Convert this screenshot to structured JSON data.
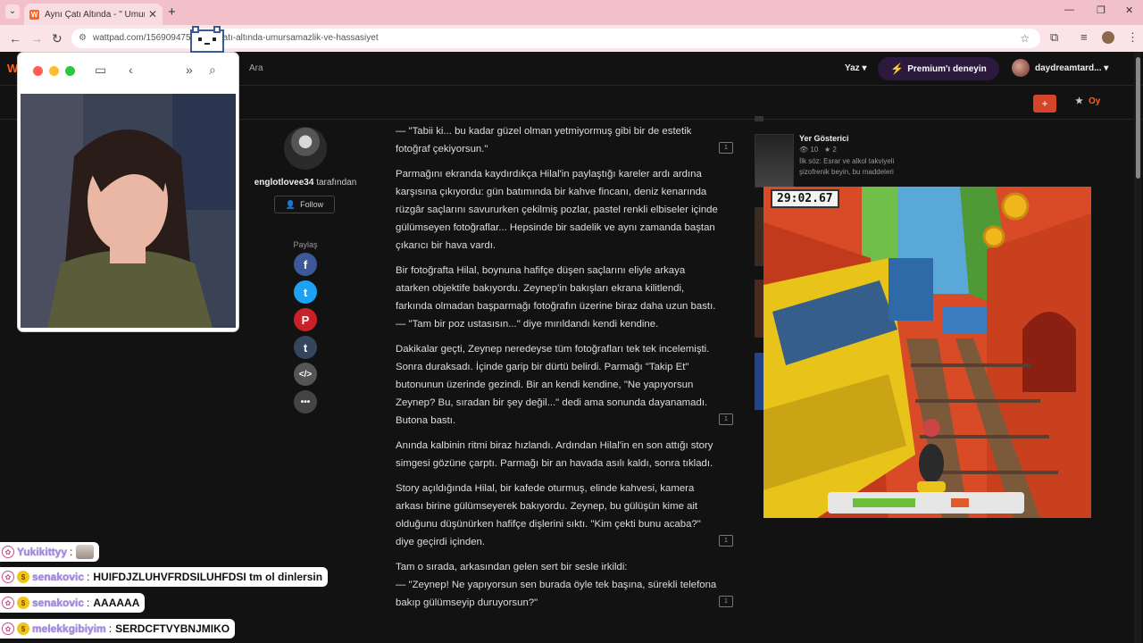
{
  "browser": {
    "tab_title": "Aynı Çatı Altında - \" Umursama...",
    "url": "wattpad.com/1569094754-aynı-çatı-altında-umursamazlik-ve-hassasiyet"
  },
  "header": {
    "logo": "W",
    "search_label": "Ara",
    "write_label": "Yaz ▾",
    "premium_label": "Premium'ı deneyin",
    "username": "daydreamtard... ▾"
  },
  "toolbar": {
    "add_label": "+",
    "vote_label": "Oy"
  },
  "author": {
    "name": "englotlovee34",
    "suffix": " tarafından",
    "follow_label": "Follow",
    "share_label": "Paylaş"
  },
  "share_icons": [
    "facebook-icon",
    "twitter-icon",
    "pinterest-icon",
    "tumblr-icon",
    "embed-icon",
    "more-icon"
  ],
  "story": {
    "paragraphs": [
      "— \"Tabii ki... bu kadar güzel olman yetmiyormuş gibi bir de estetik fotoğraf çekiyorsun.\"",
      "Parmağını ekranda kaydırdıkça Hilal'in paylaştığı kareler ardı ardına karşısına çıkıyordu: gün batımında bir kahve fincanı, deniz kenarında rüzgâr saçlarını savururken çekilmiş pozlar, pastel renkli elbiseler içinde gülümseyen fotoğraflar... Hepsinde bir sadelik ve aynı zamanda baştan çıkarıcı bir hava vardı.",
      "Bir fotoğrafta Hilal, boynuna hafifçe düşen saçlarını eliyle arkaya atarken objektife bakıyordu. Zeynep'in bakışları ekrana kilitlendi, farkında olmadan başparmağı fotoğrafın üzerine biraz daha uzun bastı.",
      "— \"Tam bir poz ustasısın...\" diye mırıldandı kendi kendine.",
      "Dakikalar geçti, Zeynep neredeyse tüm fotoğrafları tek tek incelemişti. Sonra duraksadı. İçinde garip bir dürtü belirdi. Parmağı \"Takip Et\" butonunun üzerinde gezindi. Bir an kendi kendine, \"Ne yapıyorsun Zeynep? Bu, sıradan bir şey değil...\" dedi ama sonunda dayanamadı. Butona bastı.",
      "Anında kalbinin ritmi biraz hızlandı. Ardından Hilal'in en son attığı story simgesi gözüne çarptı. Parmağı bir an havada asılı kaldı, sonra tıkladı.",
      "Story açıldığında Hilal, bir kafede oturmuş, elinde kahvesi, kamera arkası birine gülümseyerek bakıyordu. Zeynep, bu gülüşün kime ait olduğunu düşünürken hafifçe dişlerini sıktı. \"Kim çekti bunu acaba?\" diye geçirdi içinden.",
      "Tam o sırada, arkasından gelen sert bir sesle irkildi:",
      "— \"Zeynep! Ne yapıyorsun sen burada öyle tek başına, sürekli telefona bakıp gülümseyip duruyorsun?\""
    ],
    "comment_count": "1"
  },
  "recommendation": {
    "title": "Yer Gösterici",
    "reads": "10",
    "votes": "2",
    "desc1": "İlk söz: Esrar ve alkol takviyeli",
    "desc2": "şizofrenik beyin, bu maddeleri"
  },
  "game": {
    "timer": "29:02.67"
  },
  "chat": [
    {
      "nick": "Yukikittyy",
      "sep": ":",
      "msg": ""
    },
    {
      "nick": "senakovic",
      "sep": ":",
      "msg": "HUIFDJZLUHVFRDSILUHFDSI tm ol dinlersin"
    },
    {
      "nick": "senakovic",
      "sep": ":",
      "msg": "AAAAAA"
    },
    {
      "nick": "melekkgibiyim",
      "sep": ":",
      "msg": "SERDCFTVYBNJMIKO"
    }
  ],
  "colors": {
    "wattpad_orange": "#ff6122",
    "premium_purple": "#c34ff0",
    "facebook": "#3b5998",
    "twitter": "#1da1f2",
    "pinterest": "#cb2027",
    "tumblr": "#35465c"
  }
}
